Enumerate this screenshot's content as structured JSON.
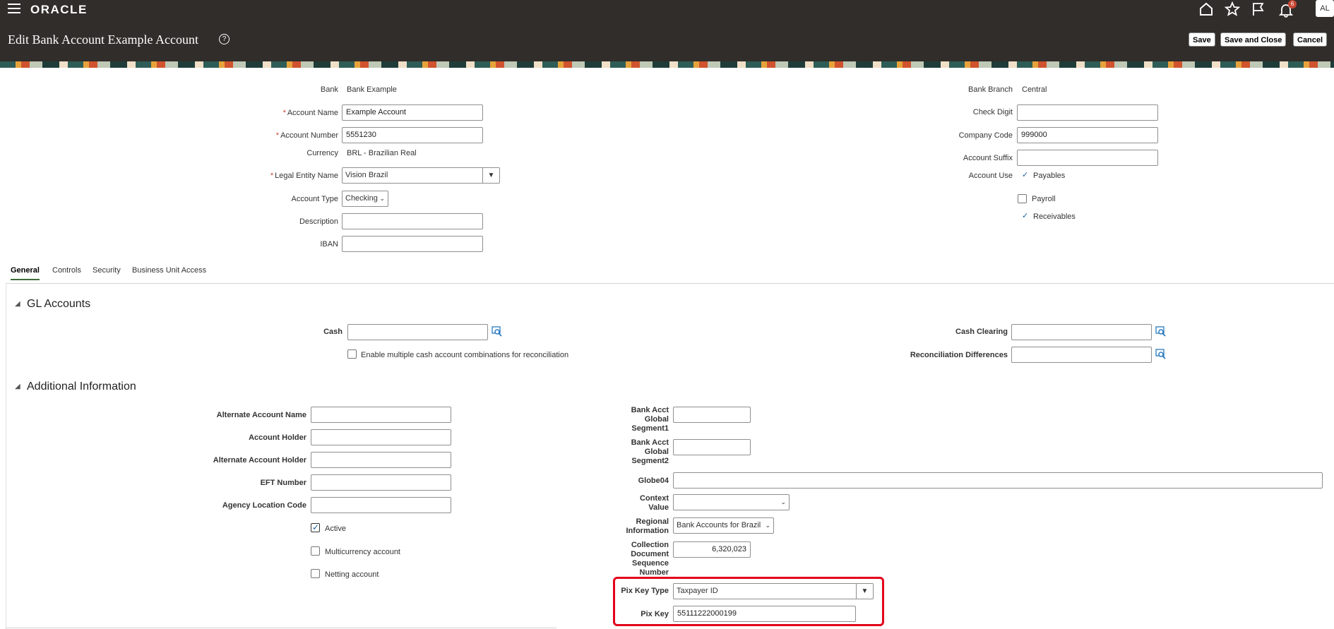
{
  "header": {
    "logo": "ORACLE",
    "title": "Edit Bank Account Example Account",
    "help": "?",
    "notifications_count": "6",
    "avatar": "AL",
    "buttons": {
      "save": "Save",
      "save_close": "Save and Close",
      "cancel": "Cancel"
    }
  },
  "form": {
    "bank_label": "Bank",
    "bank_value": "Bank Example",
    "account_name_label": "Account Name",
    "account_name_value": "Example Account",
    "account_number_label": "Account Number",
    "account_number_value": "5551230",
    "currency_label": "Currency",
    "currency_value": "BRL - Brazilian Real",
    "legal_entity_label": "Legal Entity Name",
    "legal_entity_value": "Vision Brazil",
    "account_type_label": "Account Type",
    "account_type_value": "Checking",
    "description_label": "Description",
    "description_value": "",
    "iban_label": "IBAN",
    "iban_value": "",
    "bank_branch_label": "Bank Branch",
    "bank_branch_value": "Central",
    "check_digit_label": "Check Digit",
    "check_digit_value": "",
    "company_code_label": "Company Code",
    "company_code_value": "999000",
    "account_suffix_label": "Account Suffix",
    "account_suffix_value": "",
    "account_use_label": "Account Use",
    "use_payables": "Payables",
    "use_payroll": "Payroll",
    "use_receivables": "Receivables",
    "required_mark": "*"
  },
  "tabs": [
    "General",
    "Controls",
    "Security",
    "Business Unit Access"
  ],
  "gl": {
    "title": "GL Accounts",
    "cash_label": "Cash",
    "enable_multi": "Enable multiple cash account combinations for reconciliation",
    "cash_clearing_label": "Cash Clearing",
    "recon_diff_label": "Reconciliation Differences"
  },
  "additional": {
    "title": "Additional Information",
    "alt_account_name": "Alternate Account Name",
    "account_holder": "Account Holder",
    "alt_account_holder": "Alternate Account Holder",
    "eft_number": "EFT Number",
    "agency_location": "Agency Location Code",
    "active": "Active",
    "multicurrency": "Multicurrency account",
    "netting": "Netting account",
    "seg1_l1": "Bank Acct",
    "seg1_l2": "Global",
    "seg1_l3": "Segment1",
    "seg2_l1": "Bank Acct",
    "seg2_l2": "Global",
    "seg2_l3": "Segment2",
    "globe04": "Globe04",
    "context_l1": "Context",
    "context_l2": "Value",
    "regional_l1": "Regional",
    "regional_l2": "Information",
    "regional_value": "Bank Accounts for Brazil",
    "coll_l1": "Collection",
    "coll_l2": "Document",
    "coll_l3": "Sequence",
    "coll_l4": "Number",
    "coll_value": "6,320,023",
    "pix_type_label": "Pix Key Type",
    "pix_type_value": "Taxpayer ID",
    "pix_key_label": "Pix Key",
    "pix_key_value": "55111222000199"
  }
}
